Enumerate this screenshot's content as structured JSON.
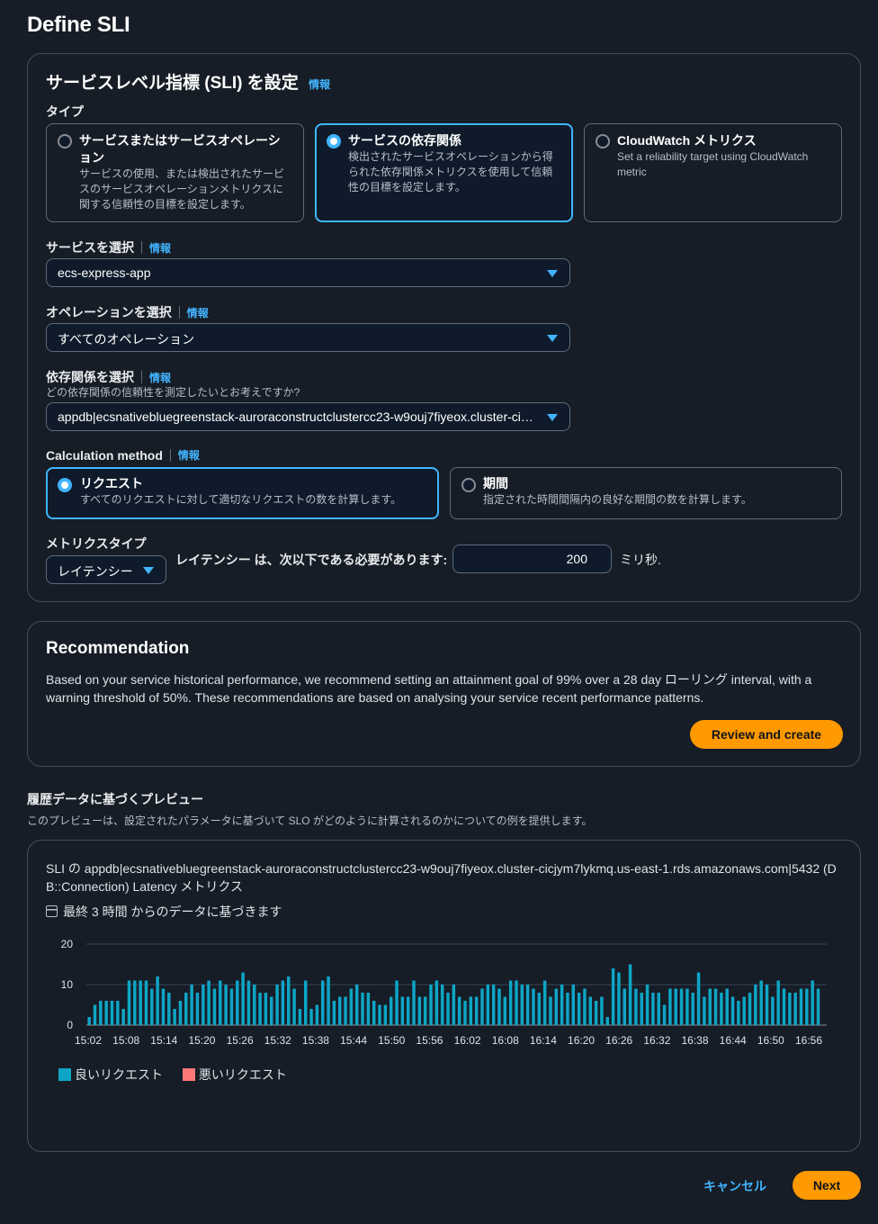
{
  "page_title": "Define SLI",
  "sli_panel": {
    "title": "サービスレベル指標 (SLI) を設定",
    "info": "情報",
    "type_label": "タイプ",
    "types": [
      {
        "title": "サービスまたはサービスオペレーション",
        "desc": "サービスの使用、または検出されたサービスのサービスオペレーションメトリクスに関する信頼性の目標を設定します。",
        "selected": false
      },
      {
        "title": "サービスの依存関係",
        "desc": "検出されたサービスオペレーションから得られた依存関係メトリクスを使用して信頼性の目標を設定します。",
        "selected": true
      },
      {
        "title": "CloudWatch メトリクス",
        "desc": "Set a reliability target using CloudWatch metric",
        "selected": false
      }
    ],
    "service_label": "サービスを選択",
    "service_value": "ecs-express-app",
    "operation_label": "オペレーションを選択",
    "operation_value": "すべてのオペレーション",
    "dependency_label": "依存関係を選択",
    "dependency_desc": "どの依存関係の信頼性を測定したいとお考えですか?",
    "dependency_value": "appdb|ecsnativebluegreenstack-auroraconstructclustercc23-w9ouj7fiyeox.cluster-cicjym7lykmq.us-east-1.rds.amazonaws.com|5432",
    "calc_label": "Calculation method",
    "calc_methods": [
      {
        "title": "リクエスト",
        "desc": "すべてのリクエストに対して適切なリクエストの数を計算します。",
        "selected": true
      },
      {
        "title": "期間",
        "desc": "指定された時間間隔内の良好な期間の数を計算します。",
        "selected": false
      }
    ],
    "metric_type_label": "メトリクスタイプ",
    "metric_type_value": "レイテンシー",
    "threshold_text": "レイテンシー は、次以下である必要があります:",
    "threshold_value": "200",
    "threshold_unit": "ミリ秒."
  },
  "recommendation": {
    "title": "Recommendation",
    "text": "Based on your service historical performance, we recommend setting an attainment goal of 99% over a 28 day ローリング interval, with a warning threshold of 50%. These recommendations are based on analysing your service recent performance patterns.",
    "button": "Review and create"
  },
  "preview": {
    "heading": "履歴データに基づくプレビュー",
    "desc": "このプレビューは、設定されたパラメータに基づいて SLO がどのように計算されるのかについての例を提供します。",
    "chart_title": "SLI の appdb|ecsnativebluegreenstack-auroraconstructclustercc23-w9ouj7fiyeox.cluster-cicjym7lykmq.us-east-1.rds.amazonaws.com|5432 (DB::Connection) Latency メトリクス",
    "period": "最終 3 時間 からのデータに基づきます"
  },
  "footer": {
    "cancel": "キャンセル",
    "next": "Next"
  },
  "colors": {
    "good": "#0ea5c6",
    "bad": "#ff7878",
    "accent": "#42b4ff",
    "primary": "#ff9900"
  },
  "chart_data": {
    "type": "bar",
    "ylim": [
      0,
      20
    ],
    "y_ticks": [
      "0",
      "10",
      "20"
    ],
    "x_ticks": [
      "15:02",
      "15:08",
      "15:14",
      "15:20",
      "15:26",
      "15:32",
      "15:38",
      "15:44",
      "15:50",
      "15:56",
      "16:02",
      "16:08",
      "16:14",
      "16:20",
      "16:26",
      "16:32",
      "16:38",
      "16:44",
      "16:50",
      "16:56"
    ],
    "series": [
      {
        "name": "良いリクエスト",
        "values": [
          2,
          5,
          6,
          6,
          6,
          6,
          4,
          11,
          11,
          11,
          11,
          9,
          12,
          9,
          8,
          4,
          6,
          8,
          10,
          8,
          10,
          11,
          9,
          11,
          10,
          9,
          11,
          13,
          11,
          10,
          8,
          8,
          7,
          10,
          11,
          12,
          9,
          4,
          11,
          4,
          5,
          11,
          12,
          6,
          7,
          7,
          9,
          10,
          8,
          8,
          6,
          5,
          5,
          7,
          11,
          7,
          7,
          11,
          7,
          7,
          10,
          11,
          10,
          8,
          10,
          7,
          6,
          7,
          7,
          9,
          10,
          10,
          9,
          7,
          11,
          11,
          10,
          10,
          9,
          8,
          11,
          7,
          9,
          10,
          8,
          10,
          8,
          9,
          7,
          6,
          7,
          2,
          14,
          13,
          9,
          15,
          9,
          8,
          10,
          8,
          8,
          5,
          9,
          9,
          9,
          9,
          8,
          13,
          7,
          9,
          9,
          8,
          9,
          7,
          6,
          7,
          8,
          10,
          11,
          10,
          7,
          11,
          9,
          8,
          8,
          9,
          9,
          11,
          9,
          0
        ]
      },
      {
        "name": "悪いリクエスト",
        "values": []
      }
    ]
  }
}
